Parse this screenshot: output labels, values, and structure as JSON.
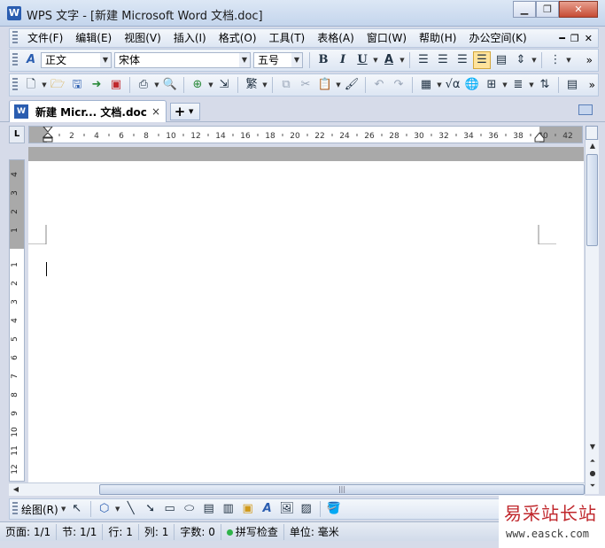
{
  "window": {
    "title": "WPS 文字 - [新建 Microsoft Word 文档.doc]",
    "app_icon": "W"
  },
  "menubar": {
    "items": [
      "文件(F)",
      "编辑(E)",
      "视图(V)",
      "插入(I)",
      "格式(O)",
      "工具(T)",
      "表格(A)",
      "窗口(W)",
      "帮助(H)",
      "办公空间(K)"
    ]
  },
  "format_toolbar": {
    "style": "正文",
    "font": "宋体",
    "size": "五号",
    "bold": "B",
    "italic": "I",
    "underline": "U",
    "font_color_glyph": "A"
  },
  "document_tab": {
    "title": "新建 Micr... 文档.doc",
    "close_glyph": "×",
    "new_glyph": "+"
  },
  "ruler": {
    "h_labels": [
      "2",
      "4",
      "6",
      "8",
      "10",
      "12",
      "14",
      "16",
      "18",
      "20",
      "22",
      "24",
      "26",
      "28",
      "30",
      "32",
      "34",
      "36",
      "38",
      "40",
      "42"
    ],
    "v_labels_above": [
      "4",
      "3",
      "2",
      "1"
    ],
    "v_labels_below": [
      "1",
      "2",
      "3",
      "4",
      "5",
      "6",
      "7",
      "8",
      "9",
      "10",
      "11",
      "12"
    ],
    "corner": "L"
  },
  "drawing_toolbar": {
    "label": "绘图(R)"
  },
  "statusbar": {
    "page": "页面: 1/1",
    "section": "节: 1/1",
    "row": "行: 1",
    "col": "列: 1",
    "word_count": "字数: 0",
    "spell_check": "拼写检查",
    "unit": "单位: 毫米"
  },
  "watermark": {
    "title": "易采站长站",
    "url": "www.easck.com"
  },
  "colors": {
    "accent": "#2a5db0",
    "active_toggle": "#ffe39b",
    "watermark_red": "#c0282d",
    "spell_ok": "#2fb34a"
  }
}
